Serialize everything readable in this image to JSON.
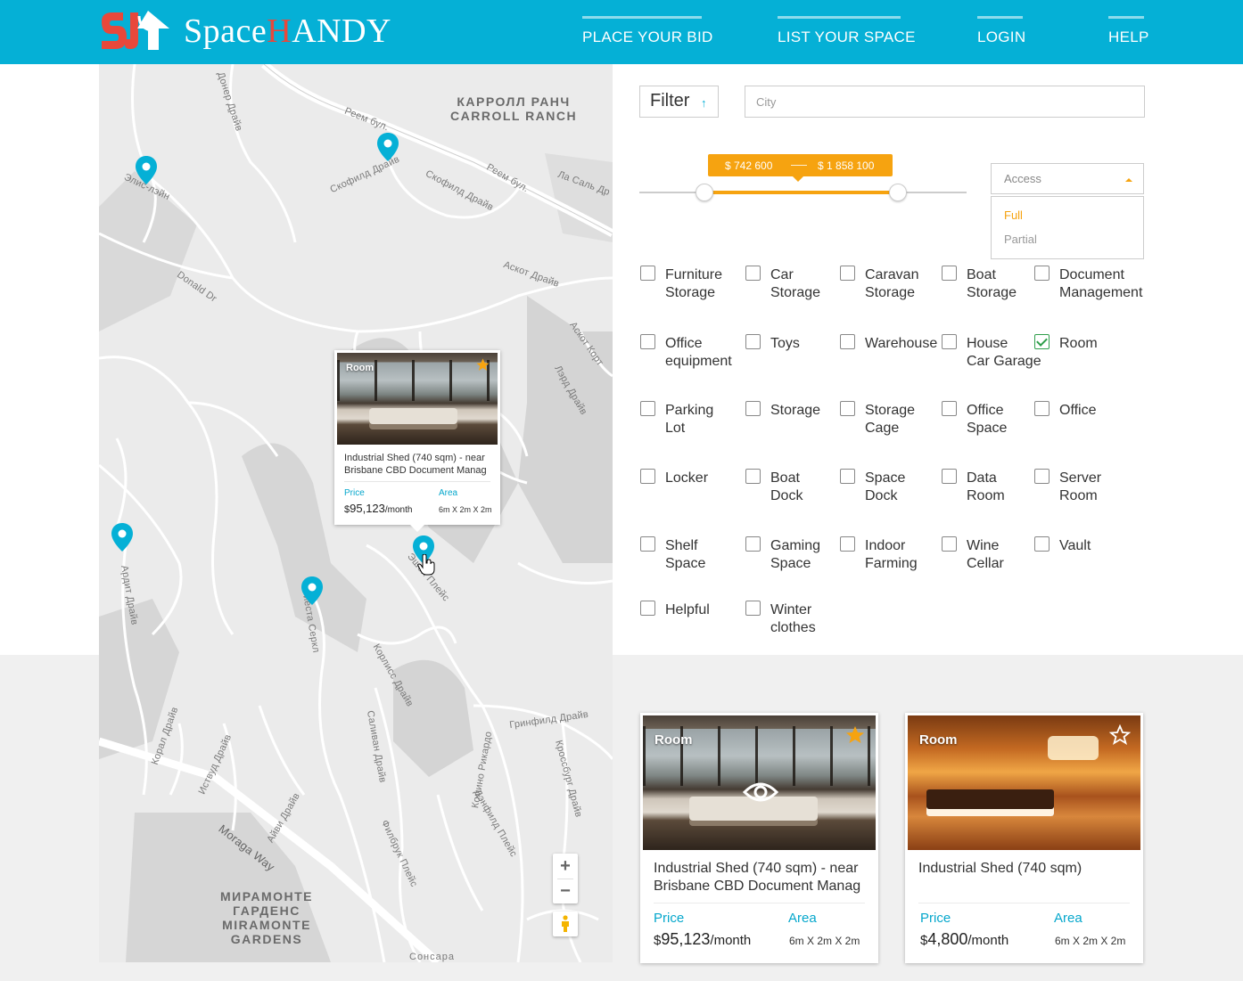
{
  "header": {
    "logo_text_a": "Space",
    "logo_text_b": "H",
    "logo_text_c": "ANDY",
    "nav": [
      "PLACE YOUR BID",
      "LIST YOUR SPACE",
      "LOGIN",
      "HELP"
    ]
  },
  "colors": {
    "brand": "#05b0d6",
    "accent": "#f6a310",
    "check": "#2e9e4a",
    "logo_red": "#e8483b"
  },
  "map": {
    "labels": [
      "Реем бул.",
      "Скофилд Драйв",
      "Скофилд Драйв",
      "Реем бул.",
      "Ла Саль Др",
      "Элис-лэйн",
      "Донер Драйв",
      "Donald Dr",
      "Аскот Драйв",
      "Аскот Корт",
      "Лэрд Драйв",
      "Ардит Драйв",
      "Фиеста Серкл",
      "Эшби Плейс",
      "Корлисс Драйв",
      "Саливан Драйв",
      "Комино Рикардо",
      "Гринфилд Драйв",
      "Кроссбург Драйв",
      "Корал Драйв",
      "Иствуд Драйв",
      "Моraga Way",
      "Айви Драйв",
      "Филбрук Плейс",
      "Дэнфилд Плейс",
      "Сонсара"
    ],
    "area_ru": [
      "КАРРОЛЛ РАНЧ",
      "МИРАМОНТЕ",
      "ГАРДЕНС"
    ],
    "area_en": [
      "CARROLL RANCH",
      "MIRAMONTE",
      "GARDENS"
    ],
    "zoom_in": "+",
    "zoom_out": "−",
    "popup": {
      "badge": "Room",
      "title": "Industrial Shed (740 sqm) - near Brisbane CBD Document Manag",
      "price_label": "Price",
      "price_currency": "$",
      "price_value": "95,123",
      "price_unit": "/month",
      "area_label": "Area",
      "area_value": "6m X 2m X 2m",
      "starred": true
    }
  },
  "filter": {
    "button_label": "Filter",
    "arrow": "↑",
    "city_placeholder": "City",
    "price_min": "$ 742 600",
    "price_max": "$ 1 858 100",
    "slider_range_fraction": [
      0.2,
      0.79
    ],
    "access": {
      "placeholder": "Access",
      "options": [
        "Full",
        "Partial"
      ],
      "highlighted": "Full"
    }
  },
  "categories": [
    {
      "label": "Furniture\nStorage",
      "checked": false
    },
    {
      "label": "Car\nStorage",
      "checked": false
    },
    {
      "label": "Caravan\nStorage",
      "checked": false
    },
    {
      "label": "Boat\nStorage",
      "checked": false
    },
    {
      "label": "Document\nManagement",
      "checked": false
    },
    {
      "label": "Office\nequipment",
      "checked": false
    },
    {
      "label": "Toys",
      "checked": false
    },
    {
      "label": "Warehouse",
      "checked": false
    },
    {
      "label": "House\nCar Garage",
      "checked": false
    },
    {
      "label": "Room",
      "checked": true
    },
    {
      "label": "Parking\nLot",
      "checked": false
    },
    {
      "label": "Storage",
      "checked": false
    },
    {
      "label": "Storage\nCage",
      "checked": false
    },
    {
      "label": "Office\nSpace",
      "checked": false
    },
    {
      "label": "Office",
      "checked": false
    },
    {
      "label": "Locker",
      "checked": false
    },
    {
      "label": "Boat\nDock",
      "checked": false
    },
    {
      "label": "Space\nDock",
      "checked": false
    },
    {
      "label": "Data\nRoom",
      "checked": false
    },
    {
      "label": "Server\nRoom",
      "checked": false
    },
    {
      "label": "Shelf\nSpace",
      "checked": false
    },
    {
      "label": "Gaming\nSpace",
      "checked": false
    },
    {
      "label": "Indoor\nFarming",
      "checked": false
    },
    {
      "label": "Wine\nCellar",
      "checked": false
    },
    {
      "label": "Vault",
      "checked": false
    },
    {
      "label": "Helpful",
      "checked": false
    },
    {
      "label": "Winter\nclothes",
      "checked": false
    }
  ],
  "cards": [
    {
      "badge": "Room",
      "title": "Industrial Shed (740 sqm) - near Brisbane CBD Document Manag",
      "price_label": "Price",
      "price_currency": "$",
      "price_value": "95,123",
      "price_unit": "/month",
      "area_label": "Area",
      "area_value": "6m X 2m X 2m",
      "starred": true,
      "eye_icon": "eye-icon"
    },
    {
      "badge": "Room",
      "title": "Industrial Shed (740 sqm)",
      "price_label": "Price",
      "price_currency": "$",
      "price_value": "4,800",
      "price_unit": "/month",
      "area_label": "Area",
      "area_value": "6m X 2m X 2m",
      "starred": false
    }
  ]
}
